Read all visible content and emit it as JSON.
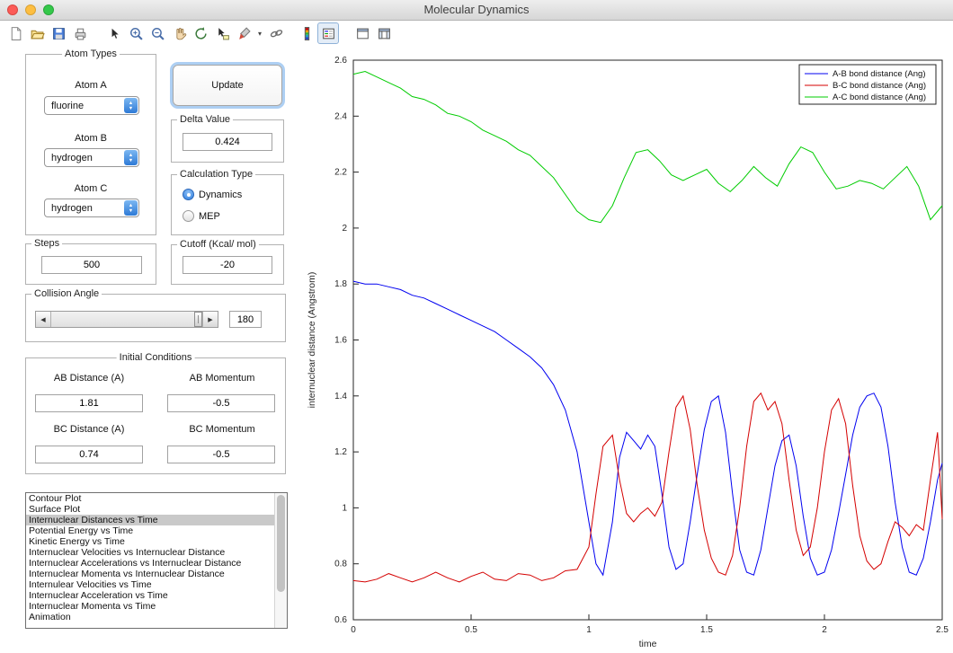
{
  "window": {
    "title": "Molecular Dynamics"
  },
  "toolbar": {
    "icon_names": [
      "new-figure",
      "open-file",
      "save-figure",
      "print-figure",
      "edit-plot",
      "zoom-in",
      "zoom-out",
      "pan",
      "rotate-3d",
      "data-cursor",
      "brush",
      "brush-menu",
      "link-plot",
      "insert-colorbar",
      "insert-legend",
      "hide-plot-tools",
      "show-plot-tools"
    ],
    "pressed_icon": "insert-legend"
  },
  "panels": {
    "update_label": "Update",
    "atom_types": {
      "title": "Atom Types",
      "atom_a_label": "Atom A",
      "atom_a_value": "fluorine",
      "atom_b_label": "Atom B",
      "atom_b_value": "hydrogen",
      "atom_c_label": "Atom C",
      "atom_c_value": "hydrogen"
    },
    "delta": {
      "title": "Delta Value",
      "value": "0.424"
    },
    "calc_type": {
      "title": "Calculation Type",
      "options": [
        {
          "label": "Dynamics",
          "selected": true
        },
        {
          "label": "MEP",
          "selected": false
        }
      ]
    },
    "steps": {
      "title": "Steps",
      "value": "500"
    },
    "cutoff": {
      "title": "Cutoff (Kcal/ mol)",
      "value": "-20"
    },
    "collision": {
      "title": "Collision Angle",
      "value": "180"
    },
    "initial": {
      "title": "Initial Conditions",
      "ab_distance_label": "AB Distance (A)",
      "ab_distance": "1.81",
      "ab_momentum_label": "AB Momentum",
      "ab_momentum": "-0.5",
      "bc_distance_label": "BC Distance (A)",
      "bc_distance": "0.74",
      "bc_momentum_label": "BC Momentum",
      "bc_momentum": "-0.5"
    }
  },
  "plot_list": {
    "selected_index": 2,
    "items": [
      "Contour Plot",
      "Surface Plot",
      "Internuclear Distances vs Time",
      "Potential Energy vs Time",
      "Kinetic Energy vs Time",
      "Internuclear Velocities vs Internuclear Distance",
      "Internuclear Accelerations vs Internuclear Distance",
      "Internuclear Momenta vs Internuclear Distance",
      "Internulear Velocities vs Time",
      "Internuclear Acceleration vs Time",
      "Internuclear Momenta vs Time",
      "Animation"
    ]
  },
  "chart_data": {
    "type": "line",
    "title": "",
    "xlabel": "time",
    "ylabel": "internuclear distance (Angstrom)",
    "xlim": [
      0,
      2.5
    ],
    "ylim": [
      0.6,
      2.6
    ],
    "xticks": [
      0,
      0.5,
      1,
      1.5,
      2,
      2.5
    ],
    "yticks": [
      0.6,
      0.8,
      1,
      1.2,
      1.4,
      1.6,
      1.8,
      2,
      2.2,
      2.4,
      2.6
    ],
    "grid": false,
    "legend": {
      "position": "top-right",
      "entries": [
        "A-B bond distance (Ang)",
        "B-C bond distance (Ang)",
        "A-C bond distance (Ang)"
      ]
    },
    "series": [
      {
        "name": "A-B bond distance (Ang)",
        "color": "#0000f0",
        "x": [
          0,
          0.05,
          0.1,
          0.15,
          0.2,
          0.25,
          0.3,
          0.35,
          0.4,
          0.45,
          0.5,
          0.55,
          0.6,
          0.65,
          0.7,
          0.75,
          0.8,
          0.85,
          0.9,
          0.95,
          1.0,
          1.03,
          1.06,
          1.1,
          1.13,
          1.16,
          1.19,
          1.22,
          1.25,
          1.28,
          1.31,
          1.34,
          1.37,
          1.4,
          1.43,
          1.46,
          1.49,
          1.52,
          1.55,
          1.58,
          1.61,
          1.64,
          1.67,
          1.7,
          1.73,
          1.76,
          1.79,
          1.82,
          1.85,
          1.88,
          1.91,
          1.94,
          1.97,
          2.0,
          2.03,
          2.06,
          2.09,
          2.12,
          2.15,
          2.18,
          2.21,
          2.24,
          2.27,
          2.3,
          2.33,
          2.36,
          2.39,
          2.42,
          2.45,
          2.48,
          2.5
        ],
        "y": [
          1.81,
          1.8,
          1.8,
          1.79,
          1.78,
          1.76,
          1.75,
          1.73,
          1.71,
          1.69,
          1.67,
          1.65,
          1.63,
          1.6,
          1.57,
          1.54,
          1.5,
          1.44,
          1.35,
          1.2,
          0.95,
          0.8,
          0.76,
          0.95,
          1.18,
          1.27,
          1.24,
          1.21,
          1.26,
          1.22,
          1.05,
          0.86,
          0.78,
          0.8,
          0.95,
          1.12,
          1.28,
          1.38,
          1.4,
          1.27,
          1.05,
          0.85,
          0.77,
          0.76,
          0.85,
          1.0,
          1.15,
          1.24,
          1.26,
          1.15,
          0.97,
          0.82,
          0.76,
          0.77,
          0.85,
          0.98,
          1.12,
          1.26,
          1.36,
          1.4,
          1.41,
          1.36,
          1.22,
          1.02,
          0.86,
          0.77,
          0.76,
          0.82,
          0.95,
          1.1,
          1.16
        ]
      },
      {
        "name": "B-C bond distance (Ang)",
        "color": "#d40000",
        "x": [
          0,
          0.05,
          0.1,
          0.15,
          0.2,
          0.25,
          0.3,
          0.35,
          0.4,
          0.45,
          0.5,
          0.55,
          0.6,
          0.65,
          0.7,
          0.75,
          0.8,
          0.85,
          0.9,
          0.95,
          1.0,
          1.03,
          1.06,
          1.1,
          1.13,
          1.16,
          1.19,
          1.22,
          1.25,
          1.28,
          1.31,
          1.34,
          1.37,
          1.4,
          1.43,
          1.46,
          1.49,
          1.52,
          1.55,
          1.58,
          1.61,
          1.64,
          1.67,
          1.7,
          1.73,
          1.76,
          1.79,
          1.82,
          1.85,
          1.88,
          1.91,
          1.94,
          1.97,
          2.0,
          2.03,
          2.06,
          2.09,
          2.12,
          2.15,
          2.18,
          2.21,
          2.24,
          2.27,
          2.3,
          2.33,
          2.36,
          2.39,
          2.42,
          2.45,
          2.48,
          2.5
        ],
        "y": [
          0.74,
          0.735,
          0.745,
          0.765,
          0.75,
          0.735,
          0.75,
          0.77,
          0.75,
          0.735,
          0.755,
          0.77,
          0.745,
          0.74,
          0.765,
          0.76,
          0.74,
          0.75,
          0.775,
          0.78,
          0.86,
          1.05,
          1.22,
          1.26,
          1.1,
          0.98,
          0.95,
          0.98,
          1.0,
          0.97,
          1.02,
          1.2,
          1.36,
          1.4,
          1.28,
          1.08,
          0.92,
          0.82,
          0.77,
          0.76,
          0.83,
          1.0,
          1.22,
          1.38,
          1.41,
          1.35,
          1.38,
          1.3,
          1.1,
          0.92,
          0.83,
          0.86,
          1.0,
          1.2,
          1.35,
          1.39,
          1.3,
          1.08,
          0.9,
          0.81,
          0.78,
          0.8,
          0.88,
          0.95,
          0.93,
          0.9,
          0.94,
          0.92,
          1.1,
          1.27,
          0.96
        ]
      },
      {
        "name": "A-C bond distance (Ang)",
        "color": "#00cc00",
        "x": [
          0,
          0.05,
          0.1,
          0.15,
          0.2,
          0.25,
          0.3,
          0.35,
          0.4,
          0.45,
          0.5,
          0.55,
          0.6,
          0.65,
          0.7,
          0.75,
          0.8,
          0.85,
          0.9,
          0.95,
          1.0,
          1.05,
          1.1,
          1.15,
          1.2,
          1.25,
          1.3,
          1.35,
          1.4,
          1.45,
          1.5,
          1.55,
          1.6,
          1.65,
          1.7,
          1.75,
          1.8,
          1.85,
          1.9,
          1.95,
          2.0,
          2.05,
          2.1,
          2.15,
          2.2,
          2.25,
          2.3,
          2.35,
          2.4,
          2.45,
          2.5
        ],
        "y": [
          2.55,
          2.56,
          2.54,
          2.52,
          2.5,
          2.47,
          2.46,
          2.44,
          2.41,
          2.4,
          2.38,
          2.35,
          2.33,
          2.31,
          2.28,
          2.26,
          2.22,
          2.18,
          2.12,
          2.06,
          2.03,
          2.02,
          2.08,
          2.18,
          2.27,
          2.28,
          2.24,
          2.19,
          2.17,
          2.19,
          2.21,
          2.16,
          2.13,
          2.17,
          2.22,
          2.18,
          2.15,
          2.23,
          2.29,
          2.27,
          2.2,
          2.14,
          2.15,
          2.17,
          2.16,
          2.14,
          2.18,
          2.22,
          2.15,
          2.03,
          2.08
        ]
      }
    ]
  }
}
